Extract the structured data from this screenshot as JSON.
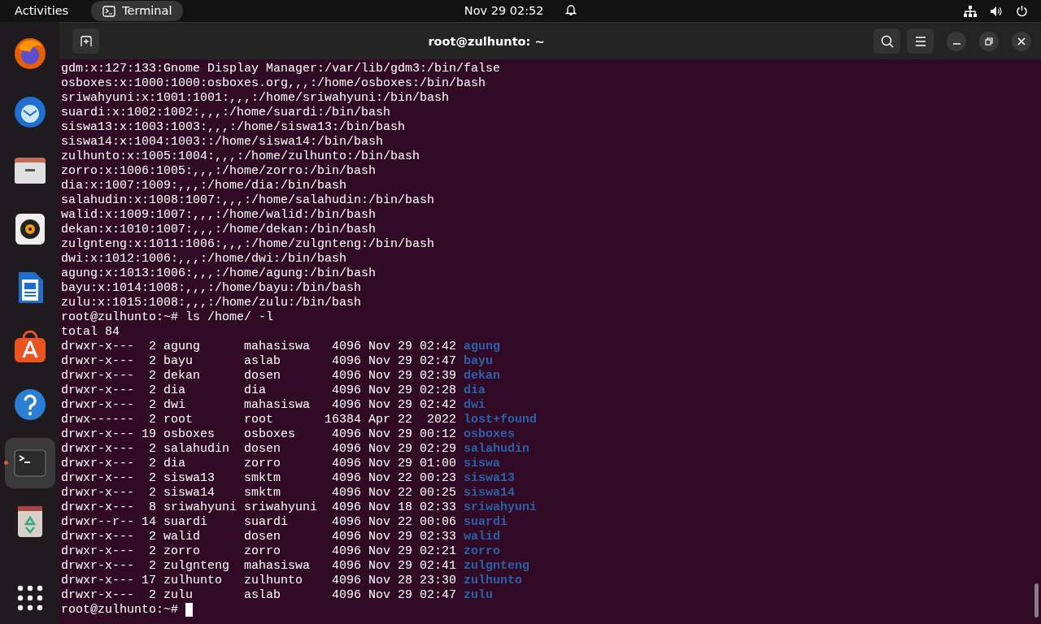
{
  "top_bar": {
    "activities": "Activities",
    "app": "Terminal",
    "clock": "Nov 29  02:52"
  },
  "dock": {
    "items": [
      {
        "kind": "firefox",
        "running": false
      },
      {
        "kind": "mail",
        "running": false
      },
      {
        "kind": "files",
        "running": false
      },
      {
        "kind": "speaker",
        "running": false
      },
      {
        "kind": "writer",
        "running": false
      },
      {
        "kind": "store",
        "running": false
      },
      {
        "kind": "help",
        "running": false
      },
      {
        "kind": "terminal",
        "running": true
      },
      {
        "kind": "trash",
        "running": false
      }
    ]
  },
  "window": {
    "title": "root@zulhunto: ~"
  },
  "terminal": {
    "lines": [
      {
        "kind": "text",
        "text": "gdm:x:127:133:Gnome Display Manager:/var/lib/gdm3:/bin/false"
      },
      {
        "kind": "text",
        "text": "osboxes:x:1000:1000:osboxes.org,,,:/home/osboxes:/bin/bash"
      },
      {
        "kind": "text",
        "text": "sriwahyuni:x:1001:1001:,,,:/home/sriwahyuni:/bin/bash"
      },
      {
        "kind": "text",
        "text": "suardi:x:1002:1002:,,,:/home/suardi:/bin/bash"
      },
      {
        "kind": "text",
        "text": "siswa13:x:1003:1003:,,,:/home/siswa13:/bin/bash"
      },
      {
        "kind": "text",
        "text": "siswa14:x:1004:1003::/home/siswa14:/bin/bash"
      },
      {
        "kind": "text",
        "text": "zulhunto:x:1005:1004:,,,:/home/zulhunto:/bin/bash"
      },
      {
        "kind": "text",
        "text": "zorro:x:1006:1005:,,,:/home/zorro:/bin/bash"
      },
      {
        "kind": "text",
        "text": "dia:x:1007:1009:,,,:/home/dia:/bin/bash"
      },
      {
        "kind": "text",
        "text": "salahudin:x:1008:1007:,,,:/home/salahudin:/bin/bash"
      },
      {
        "kind": "text",
        "text": "walid:x:1009:1007:,,,:/home/walid:/bin/bash"
      },
      {
        "kind": "text",
        "text": "dekan:x:1010:1007:,,,:/home/dekan:/bin/bash"
      },
      {
        "kind": "text",
        "text": "zulgnteng:x:1011:1006:,,,:/home/zulgnteng:/bin/bash"
      },
      {
        "kind": "text",
        "text": "dwi:x:1012:1006:,,,:/home/dwi:/bin/bash"
      },
      {
        "kind": "text",
        "text": "agung:x:1013:1006:,,,:/home/agung:/bin/bash"
      },
      {
        "kind": "text",
        "text": "bayu:x:1014:1008:,,,:/home/bayu:/bin/bash"
      },
      {
        "kind": "text",
        "text": "zulu:x:1015:1008:,,,:/home/zulu:/bin/bash"
      },
      {
        "kind": "text",
        "text": "root@zulhunto:~# ls /home/ -l"
      },
      {
        "kind": "text",
        "text": "total 84"
      },
      {
        "kind": "ls",
        "info": "drwxr-x---  2 agung      mahasiswa   4096 Nov 29 02:42",
        "name": "agung"
      },
      {
        "kind": "ls",
        "info": "drwxr-x---  2 bayu       aslab       4096 Nov 29 02:47",
        "name": "bayu"
      },
      {
        "kind": "ls",
        "info": "drwxr-x---  2 dekan      dosen       4096 Nov 29 02:39",
        "name": "dekan"
      },
      {
        "kind": "ls",
        "info": "drwxr-x---  2 dia        dia         4096 Nov 29 02:28",
        "name": "dia"
      },
      {
        "kind": "ls",
        "info": "drwxr-x---  2 dwi        mahasiswa   4096 Nov 29 02:42",
        "name": "dwi"
      },
      {
        "kind": "ls",
        "info": "drwx------  2 root       root       16384 Apr 22  2022",
        "name": "lost+found"
      },
      {
        "kind": "ls",
        "info": "drwxr-x--- 19 osboxes    osboxes     4096 Nov 29 00:12",
        "name": "osboxes"
      },
      {
        "kind": "ls",
        "info": "drwxr-x---  2 salahudin  dosen       4096 Nov 29 02:29",
        "name": "salahudin"
      },
      {
        "kind": "ls",
        "info": "drwxr-x---  2 dia        zorro       4096 Nov 29 01:00",
        "name": "siswa"
      },
      {
        "kind": "ls",
        "info": "drwxr-x---  2 siswa13    smktm       4096 Nov 22 00:23",
        "name": "siswa13"
      },
      {
        "kind": "ls",
        "info": "drwxr-x---  2 siswa14    smktm       4096 Nov 22 00:25",
        "name": "siswa14"
      },
      {
        "kind": "ls",
        "info": "drwxr-x---  8 sriwahyuni sriwahyuni  4096 Nov 18 02:33",
        "name": "sriwahyuni"
      },
      {
        "kind": "ls",
        "info": "drwxr--r-- 14 suardi     suardi      4096 Nov 22 00:06",
        "name": "suardi"
      },
      {
        "kind": "ls",
        "info": "drwxr-x---  2 walid      dosen       4096 Nov 29 02:33",
        "name": "walid"
      },
      {
        "kind": "ls",
        "info": "drwxr-x---  2 zorro      zorro       4096 Nov 29 02:21",
        "name": "zorro"
      },
      {
        "kind": "ls",
        "info": "drwxr-x---  2 zulgnteng  mahasiswa   4096 Nov 29 02:41",
        "name": "zulgnteng"
      },
      {
        "kind": "ls",
        "info": "drwxr-x--- 17 zulhunto   zulhunto    4096 Nov 28 23:30",
        "name": "zulhunto"
      },
      {
        "kind": "ls",
        "info": "drwxr-x---  2 zulu       aslab       4096 Nov 29 02:47",
        "name": "zulu"
      },
      {
        "kind": "prompt",
        "text": "root@zulhunto:~#"
      }
    ]
  }
}
